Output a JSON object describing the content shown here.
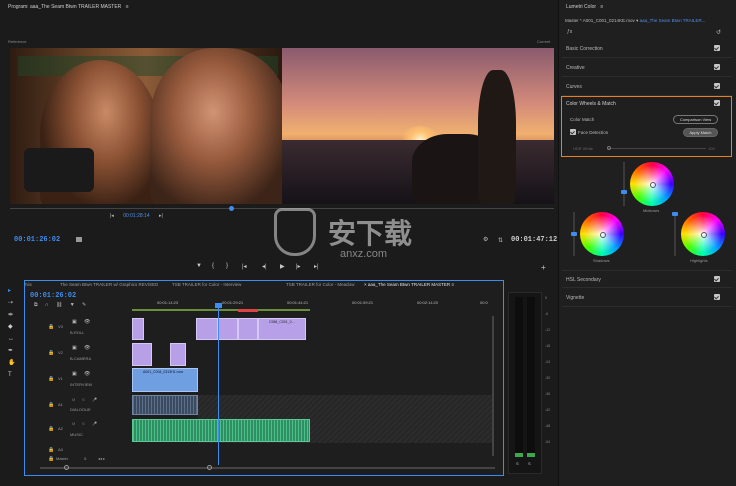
{
  "program_monitor": {
    "title": "Program: aaa_The Seam  Btwn TRAILER MASTER",
    "menu_icon": "hamburger-icon",
    "left_label": "Reference",
    "right_label": "Current",
    "ref_timecode": "00:01:28:14",
    "playhead_timecode": "00:01:26:02",
    "duration_timecode": "00:01:47:12"
  },
  "timeline": {
    "tabs": [
      "hiis",
      "The Seam  Btwn TRAILER w/ Graphics REVISED",
      "TSB TRAILER for Color - Interview",
      "TSB TRAILER for Color - Meadow",
      "aaa_The Seam  Btwn TRAILER MASTER"
    ],
    "active_tab_index": 4,
    "timecode": "00:01:26:02",
    "ruler_ticks": [
      "00:01:14:23",
      "00:01:29:21",
      "00:01:44:21",
      "00:01:59:21",
      "00:02:14:20",
      "00:0"
    ],
    "tracks": [
      {
        "id": "V3",
        "name": "B-ROLL"
      },
      {
        "id": "V2",
        "name": "B-CAMERA"
      },
      {
        "id": "V1",
        "name": "INTERVIEW"
      },
      {
        "id": "A1",
        "name": "DIALOGUE"
      },
      {
        "id": "A2",
        "name": "MUSIC"
      },
      {
        "id": "A3",
        "name": ""
      }
    ],
    "master_label": "Master",
    "master_value": "0.",
    "clip_labels": {
      "broll": "C986_C001_0…",
      "interview": "A001_C004_0313H1.mov"
    }
  },
  "meter": {
    "labels": [
      "0",
      "-6",
      "-12",
      "-18",
      "-24",
      "-30",
      "-36",
      "-42",
      "-48",
      "-54"
    ],
    "bottom": [
      "S",
      "S"
    ]
  },
  "lumetri": {
    "title": "Lumetri Color",
    "menu_icon": "hamburger-icon",
    "source": "Master * A001_C001_0214KE.mov",
    "sequence": "aaa_The Seam  Btwn TRAILER...",
    "sections": [
      {
        "label": "Basic Correction",
        "checked": true
      },
      {
        "label": "Creative",
        "checked": true
      },
      {
        "label": "Curves",
        "checked": true
      },
      {
        "label": "Color Wheels & Match",
        "checked": true
      }
    ],
    "color_match_label": "Color Match",
    "comparison_view": "Comparison View",
    "face_detection": "Face Detection",
    "apply_match": "Apply Match",
    "hdr_white": "HDR White",
    "hdr_value": "100",
    "wheels": {
      "midtones": "Midtones",
      "shadows": "Shadows",
      "highlights": "Highlights"
    },
    "hsl": "HSL Secondary",
    "vignette": "Vignette",
    "accent": "#e8811c"
  },
  "watermark": {
    "cn": "安下载",
    "en": "anxz.com"
  }
}
